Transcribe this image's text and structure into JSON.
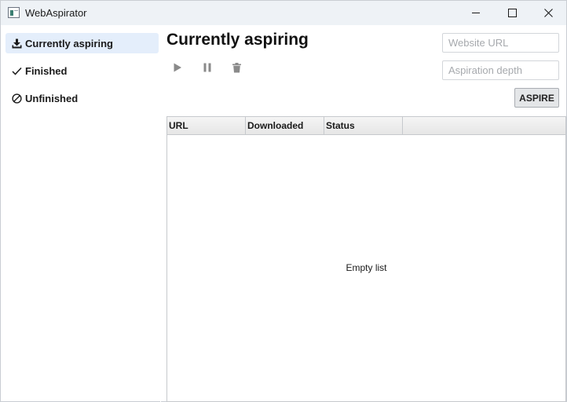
{
  "window": {
    "title": "WebAspirator",
    "icon": "app-window-icon",
    "controls": [
      "minimize-icon",
      "maximize-icon",
      "close-icon"
    ]
  },
  "sidebar": {
    "items": [
      {
        "label": "Currently aspiring",
        "icon": "download-icon",
        "selected": true
      },
      {
        "label": "Finished",
        "icon": "check-icon",
        "selected": false
      },
      {
        "label": "Unfinished",
        "icon": "prohibited-icon",
        "selected": false
      }
    ]
  },
  "main": {
    "title": "Currently aspiring",
    "toolbar": [
      "play-icon",
      "pause-icon",
      "trash-icon"
    ],
    "url_input": {
      "placeholder": "Website URL",
      "value": ""
    },
    "depth_input": {
      "placeholder": "Aspiration depth",
      "value": ""
    },
    "aspire_label": "ASPIRE",
    "table": {
      "columns": [
        "URL",
        "Downloaded",
        "Status"
      ],
      "rows": [],
      "empty_text": "Empty list"
    }
  },
  "colors": {
    "titlebar_bg": "#eef2f6",
    "selected_item_bg": "#e4eefb",
    "icon_gray": "#8a8a8a"
  }
}
